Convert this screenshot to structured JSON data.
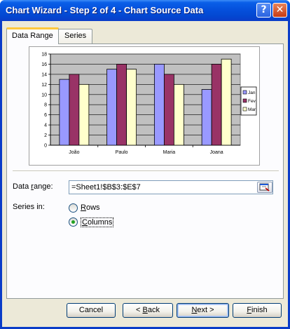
{
  "window": {
    "title": "Chart Wizard - Step 2 of 4 - Chart Source Data",
    "help_glyph": "?",
    "close_glyph": "✕"
  },
  "tabs": [
    {
      "label": "Data Range",
      "active": true
    },
    {
      "label": "Series",
      "active": false
    }
  ],
  "chart_data": {
    "type": "bar",
    "categories": [
      "João",
      "Paulo",
      "Maria",
      "Joana"
    ],
    "series": [
      {
        "name": "Jan",
        "values": [
          13,
          15,
          16,
          11
        ],
        "color": "#9999ff"
      },
      {
        "name": "Fev",
        "values": [
          14,
          16,
          14,
          16
        ],
        "color": "#993366"
      },
      {
        "name": "Mar",
        "values": [
          12,
          15,
          12,
          17
        ],
        "color": "#ffffcc"
      }
    ],
    "yticks": [
      "0",
      "2",
      "4",
      "6",
      "8",
      "10",
      "12",
      "14",
      "16",
      "18"
    ],
    "ylim": [
      0,
      18
    ],
    "grid": true,
    "plot_background": "#c0c0c0",
    "legend_position": "right"
  },
  "form": {
    "data_range_label_pre": "Data ",
    "data_range_label_u": "r",
    "data_range_label_post": "ange:",
    "data_range_value": "=Sheet1!$B$3:$E$7",
    "series_in_label": "Series in:",
    "rows_pre": "",
    "rows_u": "R",
    "rows_post": "ows",
    "columns_pre": "",
    "columns_u": "C",
    "columns_post": "olumns",
    "series_in_selected": "Columns"
  },
  "buttons": {
    "cancel": "Cancel",
    "back_pre": "< ",
    "back_u": "B",
    "back_post": "ack",
    "next_pre": "",
    "next_u": "N",
    "next_post": "ext >",
    "finish_pre": "",
    "finish_u": "F",
    "finish_post": "inish"
  }
}
